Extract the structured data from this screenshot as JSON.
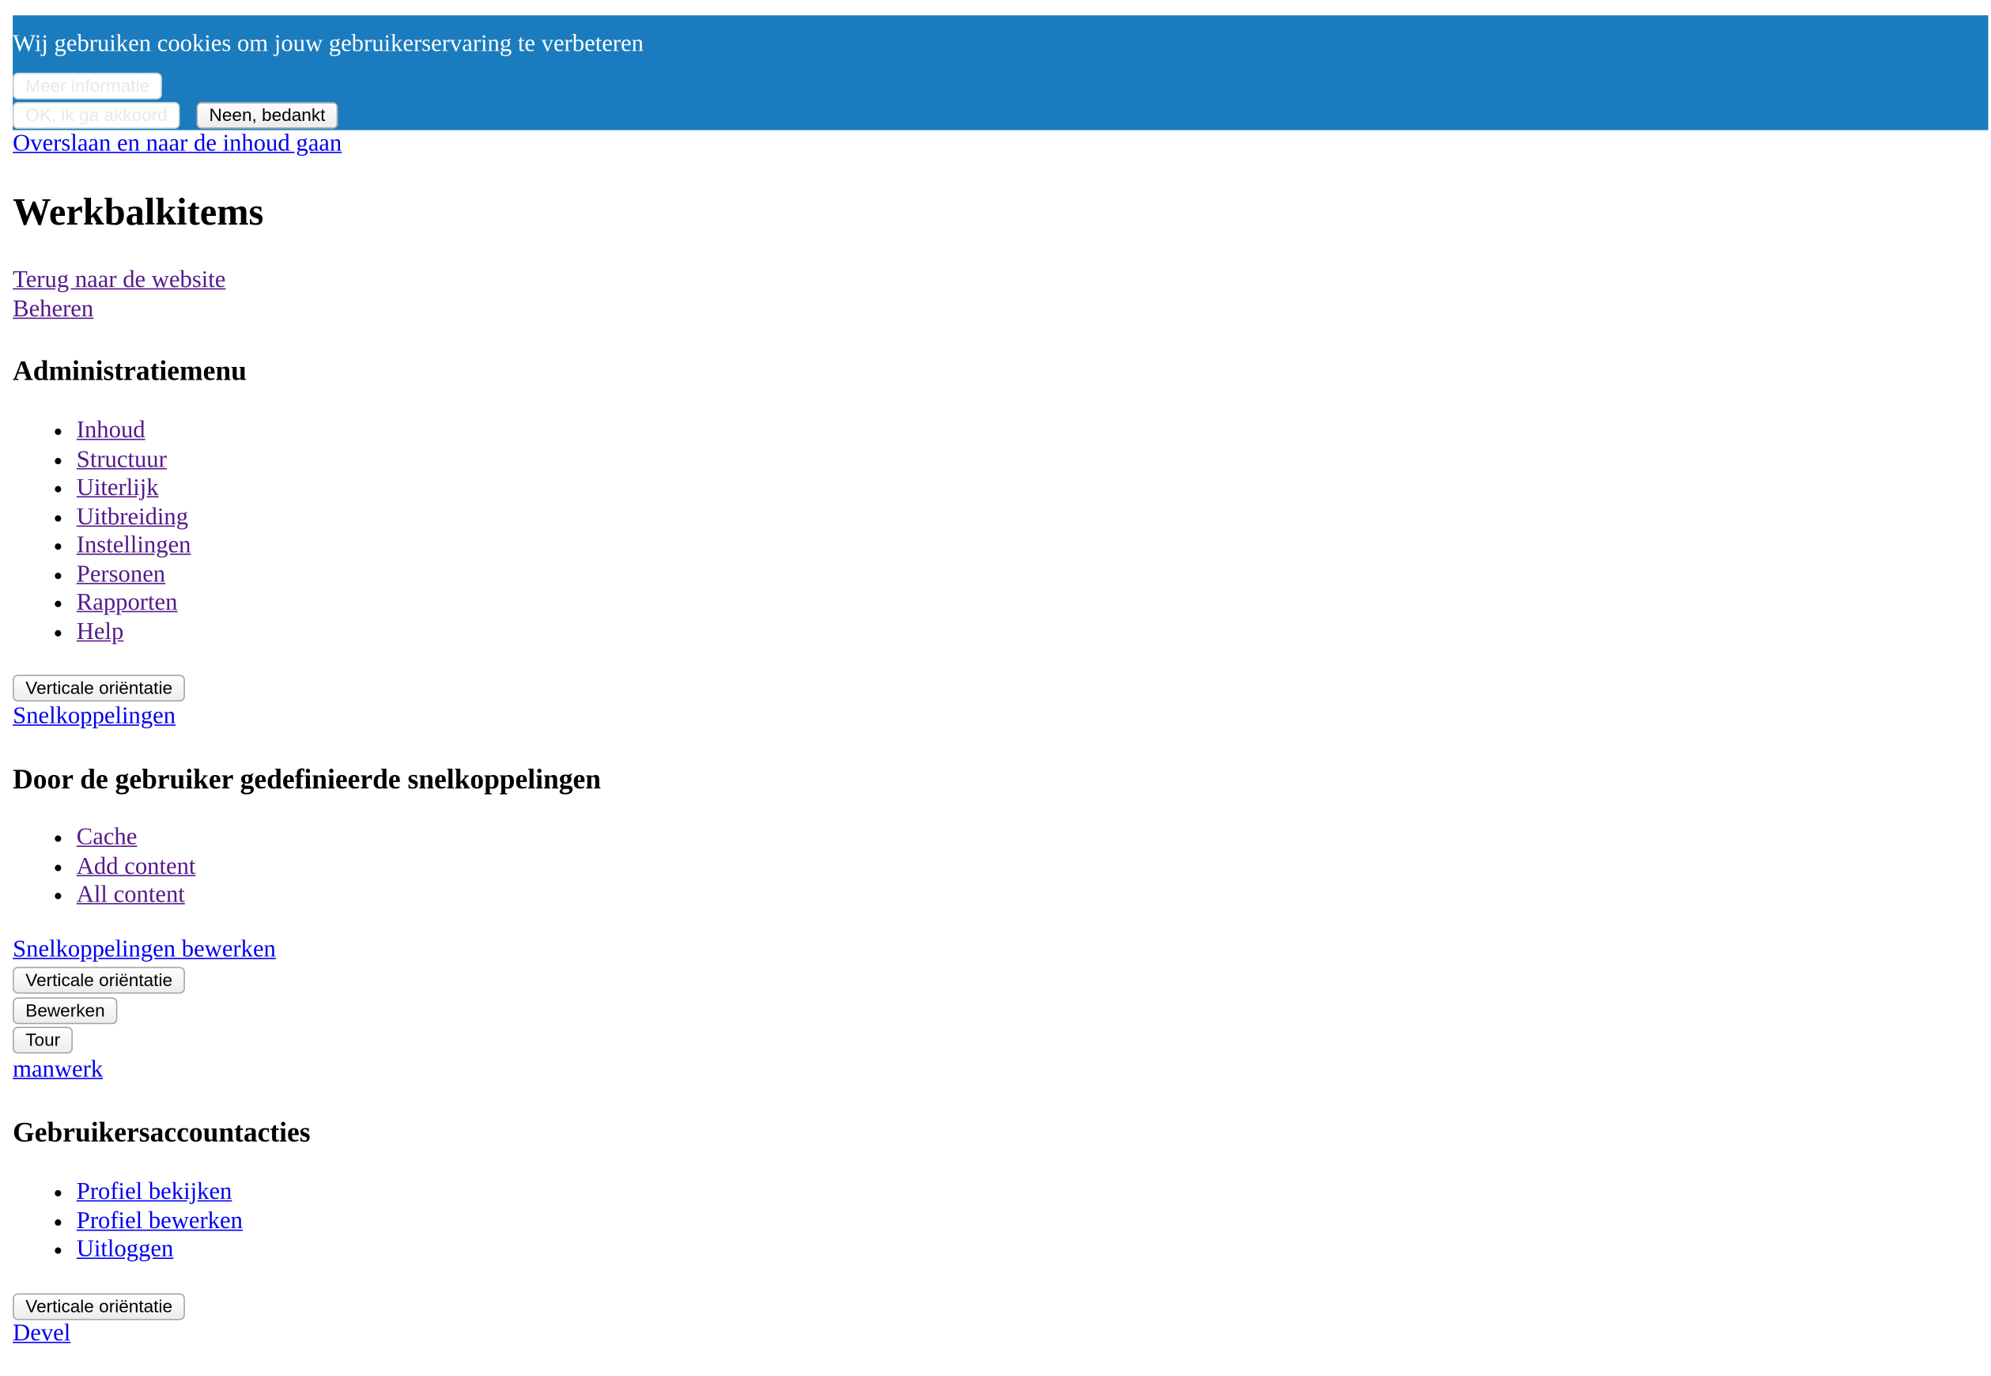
{
  "cookie_banner": {
    "message": "Wij gebruiken cookies om jouw gebruikerservaring te verbeteren",
    "more_info_label": "Meer informatie",
    "agree_label": "OK, ik ga akkoord",
    "decline_label": "Neen, bedankt",
    "background_color": "#1a7cbe"
  },
  "skip_link": "Overslaan en naar de inhoud gaan",
  "toolbar": {
    "heading": "Werkbalkitems",
    "back_to_site": "Terug naar de website",
    "manage": "Beheren",
    "admin_menu": {
      "heading": "Administratiemenu",
      "items": [
        "Inhoud",
        "Structuur",
        "Uiterlijk",
        "Uitbreiding",
        "Instellingen",
        "Personen",
        "Rapporten",
        "Help"
      ],
      "orientation_label": "Verticale oriëntatie"
    },
    "shortcuts": {
      "tab_label": "Snelkoppelingen",
      "heading": "Door de gebruiker gedefinieerde snelkoppelingen",
      "items": [
        "Cache",
        "Add content",
        "All content"
      ],
      "edit_label": "Snelkoppelingen bewerken",
      "orientation_label": "Verticale oriëntatie"
    },
    "edit_button": "Bewerken",
    "tour_button": "Tour",
    "user": {
      "name": "manwerk",
      "heading": "Gebruikersaccountacties",
      "items": [
        "Profiel bekijken",
        "Profiel bewerken",
        "Uitloggen"
      ],
      "orientation_label": "Verticale oriëntatie"
    },
    "devel": "Devel"
  }
}
